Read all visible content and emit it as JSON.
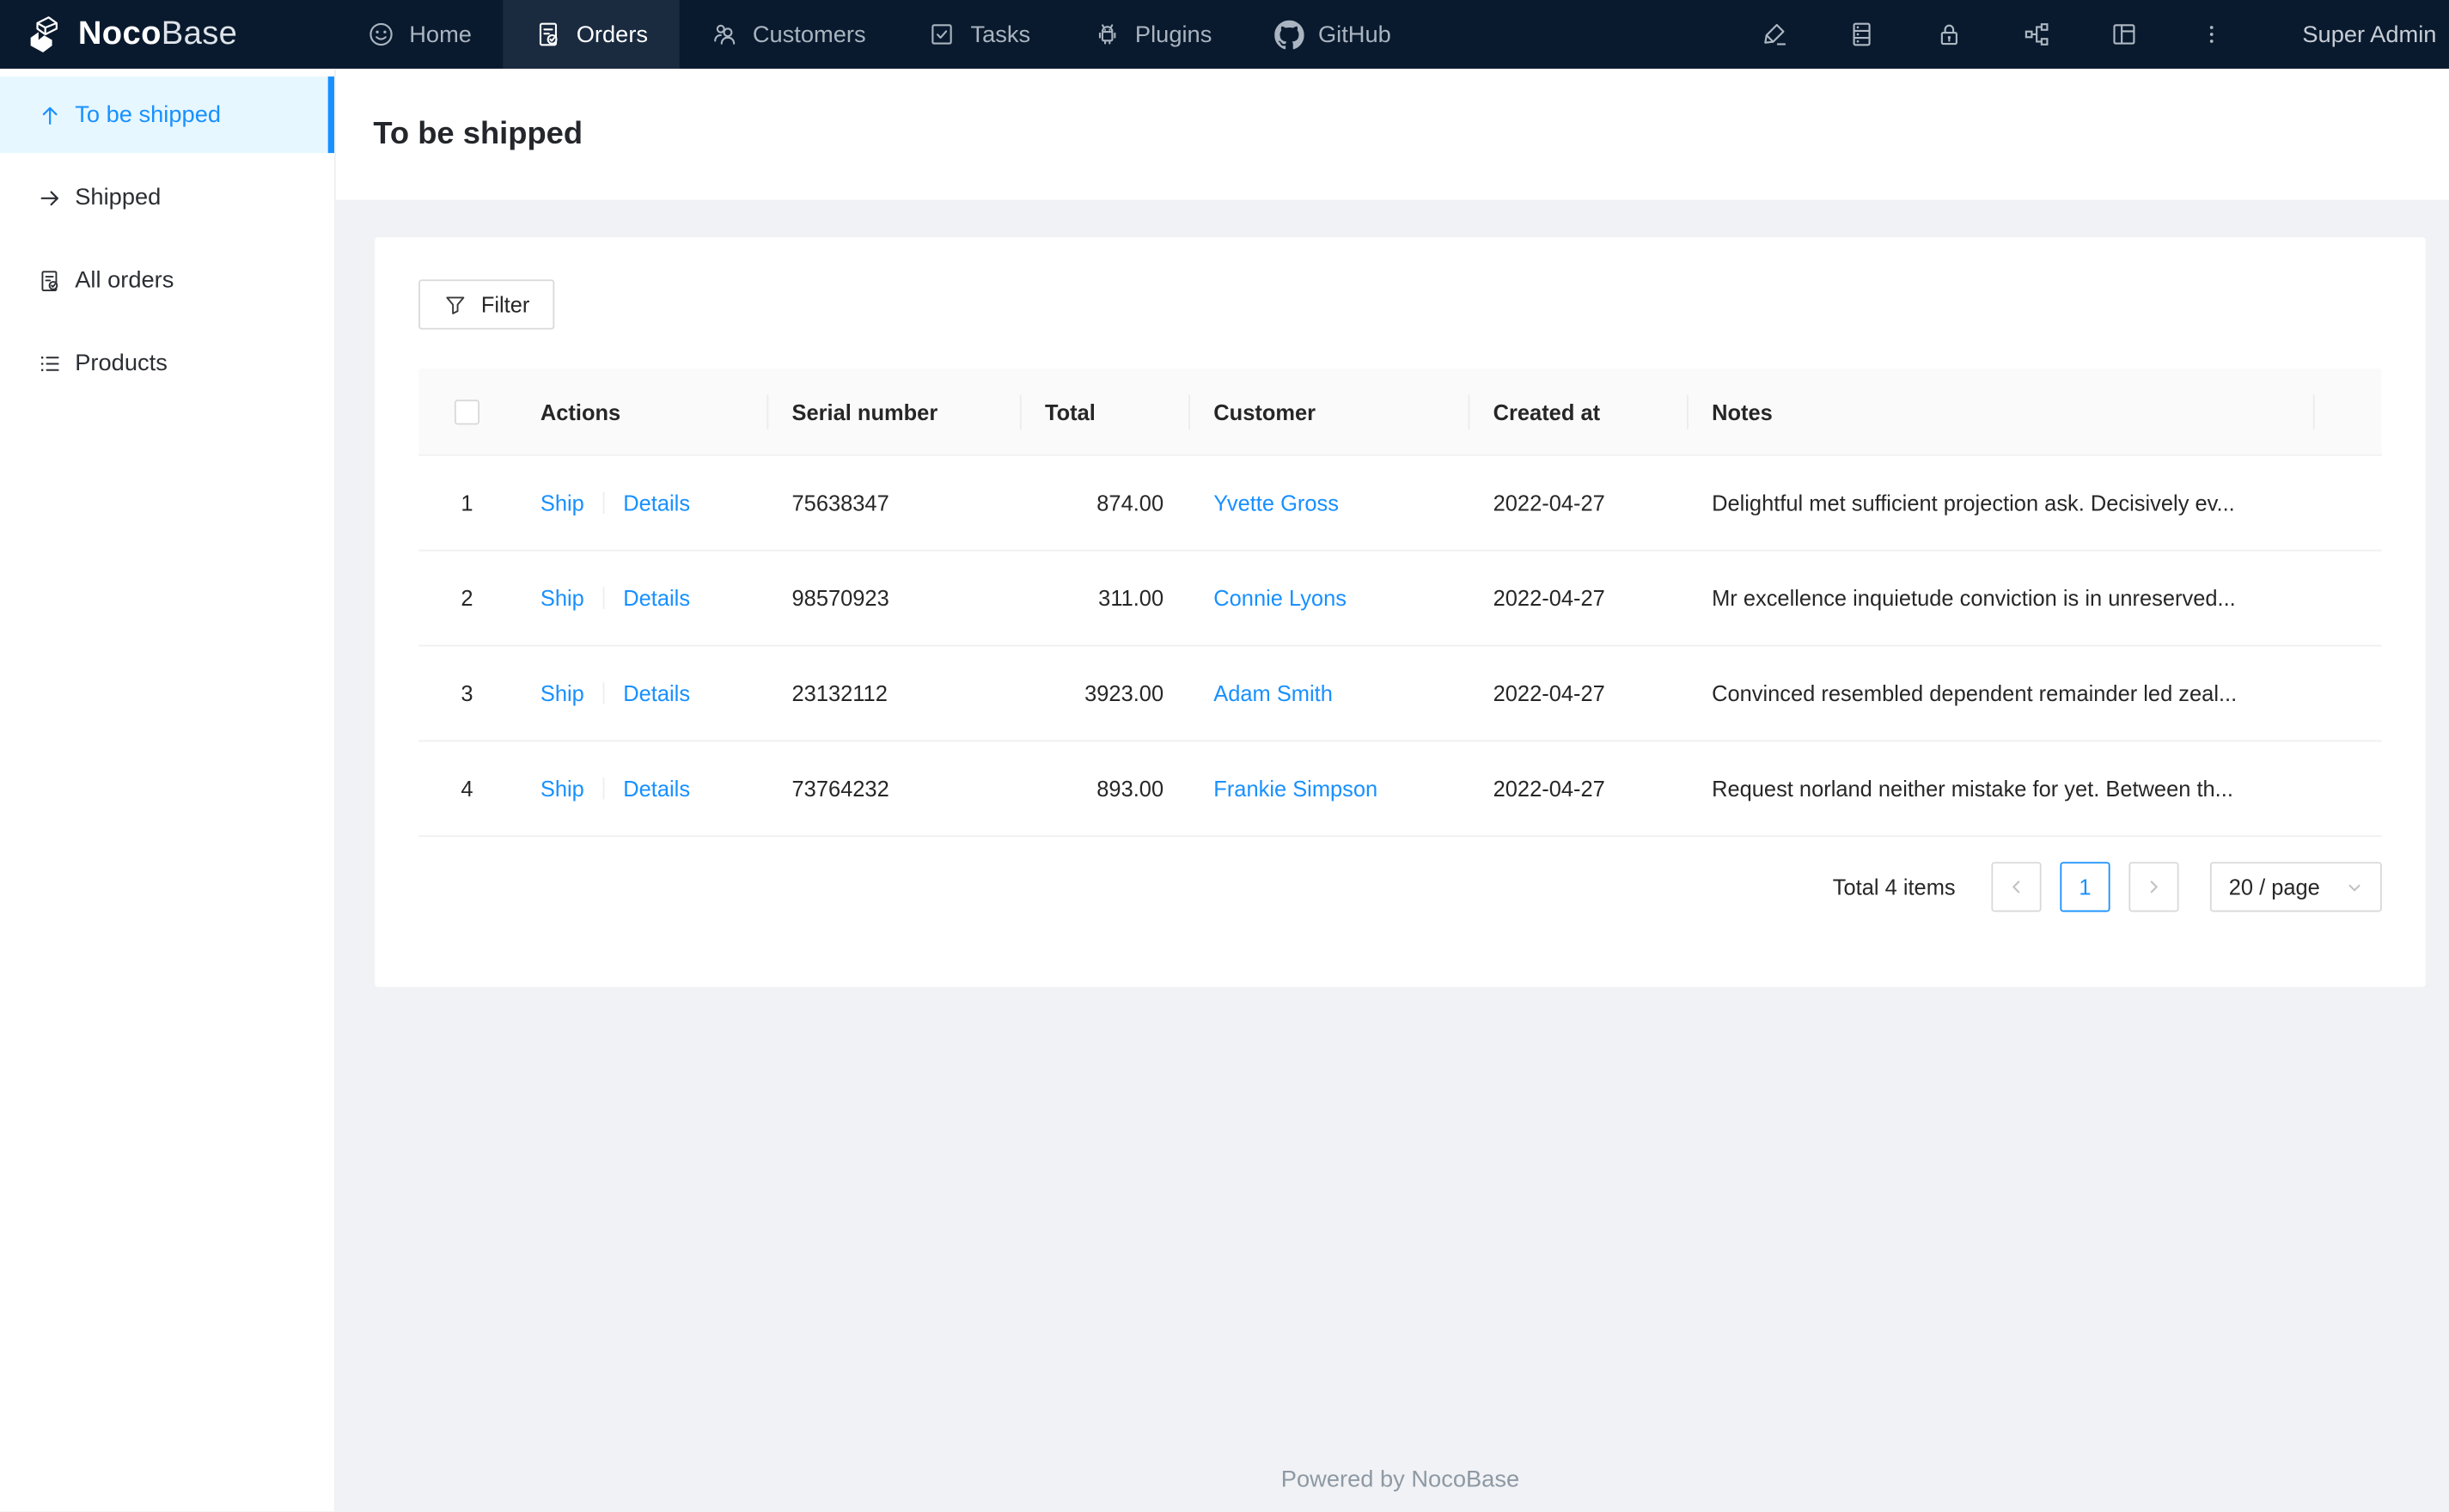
{
  "navbar": {
    "logo": {
      "part1": "Noco",
      "part2": "Base"
    },
    "items": [
      {
        "label": "Home",
        "icon": "smiley-icon",
        "active": false
      },
      {
        "label": "Orders",
        "icon": "order-file-icon",
        "active": true
      },
      {
        "label": "Customers",
        "icon": "customers-icon",
        "active": false
      },
      {
        "label": "Tasks",
        "icon": "check-square-icon",
        "active": false
      },
      {
        "label": "Plugins",
        "icon": "android-icon",
        "active": false
      },
      {
        "label": "GitHub",
        "icon": "github-icon",
        "active": false
      }
    ],
    "right_icons": [
      "highlighter-icon",
      "database-icon",
      "lock-icon",
      "org-chart-icon",
      "layout-icon",
      "more-icon"
    ],
    "user": "Super Admin"
  },
  "sidebar": {
    "items": [
      {
        "label": "To be shipped",
        "icon": "arrow-up-icon",
        "active": true
      },
      {
        "label": "Shipped",
        "icon": "arrow-right-icon",
        "active": false
      },
      {
        "label": "All orders",
        "icon": "file-done-icon",
        "active": false
      },
      {
        "label": "Products",
        "icon": "list-icon",
        "active": false
      }
    ]
  },
  "page": {
    "title": "To be shipped"
  },
  "toolbar": {
    "filter_label": "Filter"
  },
  "table": {
    "columns": {
      "actions": "Actions",
      "serial": "Serial number",
      "total": "Total",
      "customer": "Customer",
      "created": "Created at",
      "notes": "Notes"
    },
    "rows": [
      {
        "index": "1",
        "ship": "Ship",
        "details": "Details",
        "serial": "75638347",
        "total": "874.00",
        "customer": "Yvette Gross",
        "created": "2022-04-27",
        "notes": "Delightful met sufficient projection ask. Decisively ev..."
      },
      {
        "index": "2",
        "ship": "Ship",
        "details": "Details",
        "serial": "98570923",
        "total": "311.00",
        "customer": "Connie Lyons",
        "created": "2022-04-27",
        "notes": "Mr excellence inquietude conviction is in unreserved..."
      },
      {
        "index": "3",
        "ship": "Ship",
        "details": "Details",
        "serial": "23132112",
        "total": "3923.00",
        "customer": "Adam Smith",
        "created": "2022-04-27",
        "notes": "Convinced resembled dependent remainder led zeal..."
      },
      {
        "index": "4",
        "ship": "Ship",
        "details": "Details",
        "serial": "73764232",
        "total": "893.00",
        "customer": "Frankie Simpson",
        "created": "2022-04-27",
        "notes": "Request norland neither mistake for yet. Between th..."
      }
    ]
  },
  "pagination": {
    "total_text": "Total 4 items",
    "current_page": "1",
    "page_size_label": "20 / page"
  },
  "footer": {
    "text": "Powered by NocoBase"
  },
  "colors": {
    "accent": "#1890ff",
    "navbar_bg": "#0a1a2e",
    "navbar_active_bg": "#1a2b40",
    "sidebar_active_bg": "#e6f7ff",
    "content_bg": "#f0f2f5",
    "table_header_bg": "#fafafa",
    "border": "#f0f0f0"
  }
}
